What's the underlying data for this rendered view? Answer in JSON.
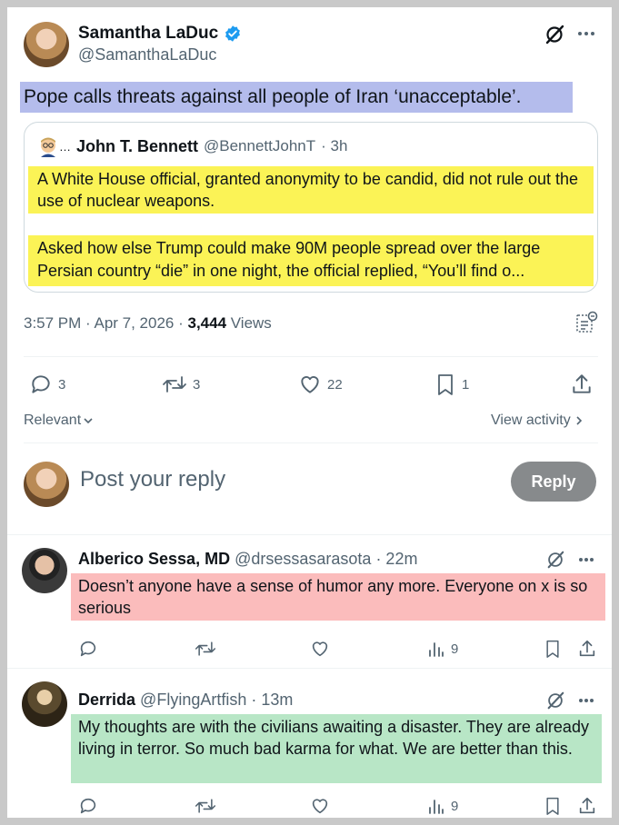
{
  "main_post": {
    "author_name": "Samantha LaDuc",
    "author_handle": "@SamanthaLaDuc",
    "text": "Pope calls threats against all people of Iran ‘unacceptable’.",
    "quote": {
      "author_name": "John T. Bennett",
      "author_handle": "@BennettJohnT",
      "time": "· 3h",
      "paragraph1": "A White House official, granted anonymity to be candid, did not rule out the use of nuclear weapons.",
      "paragraph2": "Asked how else Trump could make 90M people spread over the large Persian country “die” in one night, the official replied, “You’ll find o..."
    },
    "timestamp": "3:57 PM · Apr 7, 2026 · ",
    "views_count": "3,444",
    "views_label": " Views",
    "stats": {
      "replies": "3",
      "reposts": "3",
      "likes": "22",
      "bookmarks": "1"
    }
  },
  "sort": {
    "label": "Relevant",
    "view_activity": "View activity"
  },
  "reply_box": {
    "placeholder": "Post your reply",
    "button": "Reply"
  },
  "replies": [
    {
      "author_name": "Alberico Sessa, MD",
      "author_handle": "@drsessasarasota",
      "time": "· 22m",
      "text": "Doesn’t anyone have a sense of humor any more.  Everyone on x is so serious",
      "views": "9"
    },
    {
      "author_name": "Derrida",
      "author_handle": "@FlyingArtfish",
      "time": "· 13m",
      "text": "My thoughts are with the civilians awaiting a disaster.  They are already living in terror.  So much bad karma for what. We are better than this.",
      "views": "9"
    }
  ],
  "colors": {
    "highlight_blue": "#b4bcec",
    "highlight_yellow": "#fbf356",
    "highlight_pink": "#fbbcbc",
    "highlight_green": "#b8e6c6",
    "verified": "#1d9bf0",
    "reply_button": "#878a8c"
  }
}
